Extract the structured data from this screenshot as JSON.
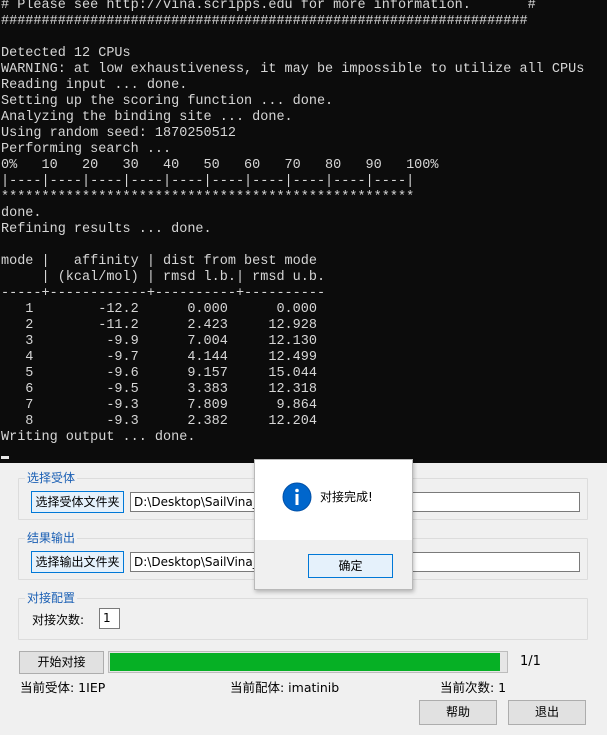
{
  "console": {
    "lines": [
      "# Please see http://vina.scripps.edu for more information.       #",
      "#################################################################",
      "",
      "Detected 12 CPUs",
      "WARNING: at low exhaustiveness, it may be impossible to utilize all CPUs",
      "Reading input ... done.",
      "Setting up the scoring function ... done.",
      "Analyzing the binding site ... done.",
      "Using random seed: 1870250512",
      "Performing search ...",
      "0%   10   20   30   40   50   60   70   80   90   100%",
      "|----|----|----|----|----|----|----|----|----|----|",
      "***************************************************",
      "done.",
      "Refining results ... done.",
      "",
      "mode |   affinity | dist from best mode",
      "     | (kcal/mol) | rmsd l.b.| rmsd u.b.",
      "-----+------------+----------+----------",
      "   1        -12.2      0.000      0.000",
      "   2        -11.2      2.423     12.928",
      "   3         -9.9      7.004     12.130",
      "   4         -9.7      4.144     12.499",
      "   5         -9.6      9.157     15.044",
      "   6         -9.5      3.383     12.318",
      "   7         -9.3      7.809      9.864",
      "   8         -9.3      2.382     12.204",
      "Writing output ... done."
    ]
  },
  "receptor": {
    "group_label": "选择受体",
    "button_label": "选择受体文件夹",
    "path": "D:\\Desktop\\SailVina_t"
  },
  "output": {
    "group_label": "结果输出",
    "button_label": "选择输出文件夹",
    "path": "D:\\Desktop\\SailVina_t"
  },
  "config": {
    "group_label": "对接配置",
    "count_label": "对接次数:",
    "count_value": "1"
  },
  "run": {
    "start_label": "开始对接",
    "progress_fraction": 1.0,
    "progress_text": "1/1",
    "progress_color": "#06b025"
  },
  "status": {
    "receptor": "当前受体: 1IEP",
    "ligand": "当前配体: imatinib",
    "count": "当前次数: 1"
  },
  "footer": {
    "help_label": "帮助",
    "exit_label": "退出"
  },
  "dialog": {
    "message": "对接完成!",
    "ok_label": "确定",
    "icon": "info-icon",
    "icon_color": "#0066cc"
  },
  "colors": {
    "console_bg": "#0c0c0c",
    "console_fg": "#d6d6d6",
    "group_label": "#1a5fb4",
    "window_bg": "#f0f0f0"
  }
}
